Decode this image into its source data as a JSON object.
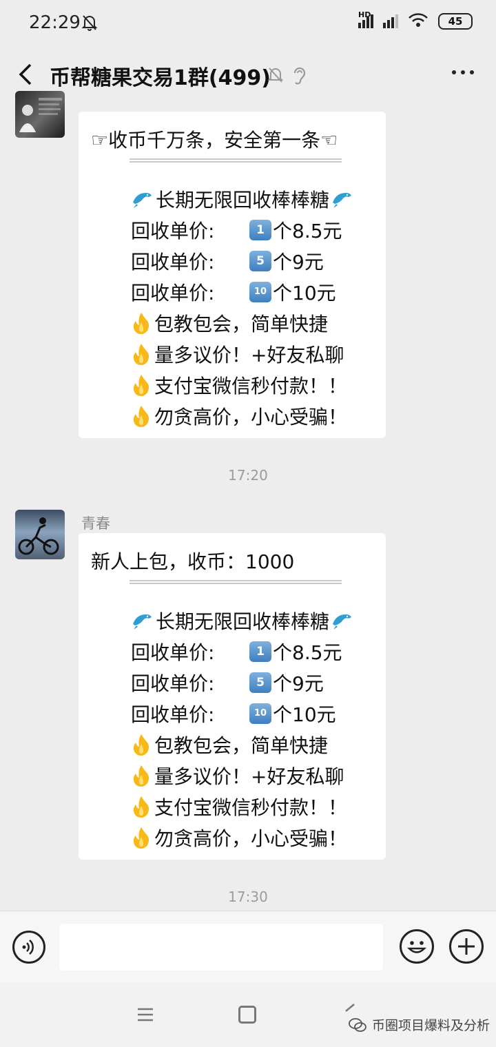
{
  "status_bar": {
    "time": "22:29",
    "network_label": "HD",
    "battery": "45"
  },
  "title_bar": {
    "title": "币帮糖果交易1群(499)"
  },
  "messages": [
    {
      "sender": "",
      "header": "☞收币千万条，安全第一条☜",
      "offer_title": "长期无限回收棒棒糖",
      "prices": [
        {
          "label": "回收单价:",
          "key": "1",
          "text": "个8.5元"
        },
        {
          "label": "回收单价:",
          "key": "5",
          "text": "个9元"
        },
        {
          "label": "回收单价:",
          "key": "10",
          "text": "个10元"
        }
      ],
      "notes": [
        "包教包会，简单快捷",
        "量多议价！+好友私聊",
        "支付宝微信秒付款！！",
        "勿贪高价，小心受骗！"
      ]
    },
    {
      "sender": "青春",
      "header": "新人上包，收币：1000",
      "offer_title": "长期无限回收棒棒糖",
      "prices": [
        {
          "label": "回收单价:",
          "key": "1",
          "text": "个8.5元"
        },
        {
          "label": "回收单价:",
          "key": "5",
          "text": "个9元"
        },
        {
          "label": "回收单价:",
          "key": "10",
          "text": "个10元"
        }
      ],
      "notes": [
        "包教包会，简单快捷",
        "量多议价！+好友私聊",
        "支付宝微信秒付款！！",
        "勿贪高价，小心受骗！"
      ]
    }
  ],
  "timestamps": [
    "17:20",
    "17:30"
  ],
  "watermark": {
    "text": "币圈项目爆料及分析"
  },
  "icons": {
    "back": "back-arrow-icon",
    "mute": "bell-off-icon",
    "ear": "ear-icon",
    "more": "more-icon",
    "voice": "voice-icon",
    "emoji": "emoji-icon",
    "add": "plus-icon",
    "dolphin": "dolphin-icon",
    "fire": "fire-icon",
    "keycap": "keycap-number-icon"
  }
}
